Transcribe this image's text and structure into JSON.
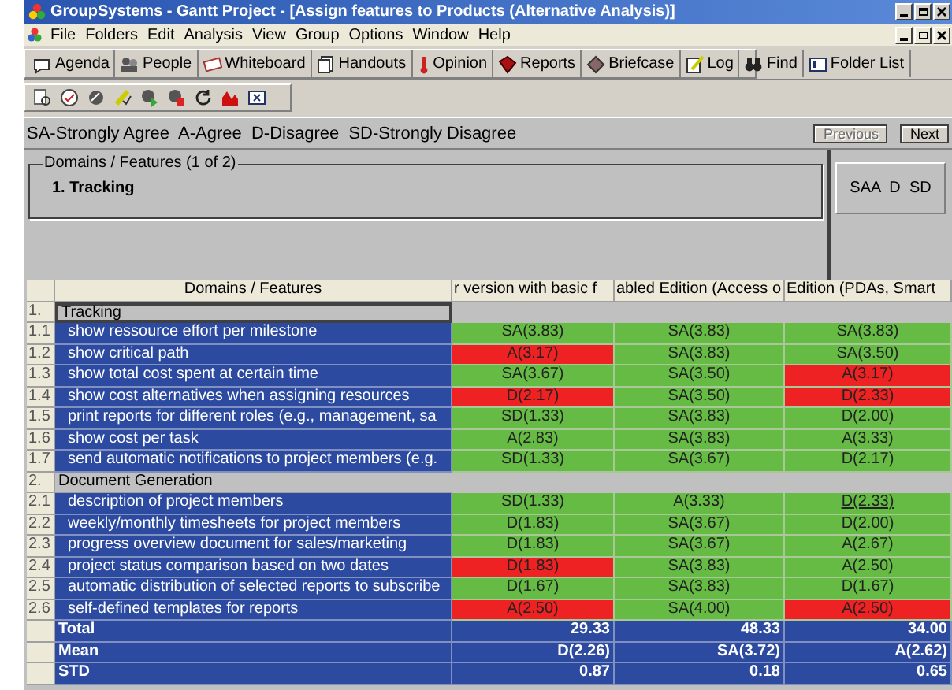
{
  "window": {
    "title": "GroupSystems - Gantt Project - [Assign features to Products (Alternative Analysis)]"
  },
  "menu": [
    "File",
    "Folders",
    "Edit",
    "Analysis",
    "View",
    "Group",
    "Options",
    "Window",
    "Help"
  ],
  "toolbar": [
    "Agenda",
    "People",
    "Whiteboard",
    "Handouts",
    "Opinion",
    "Reports",
    "Briefcase",
    "Log",
    "Find",
    "Folder List"
  ],
  "legend": "SA-Strongly Agree  A-Agree  D-Disagree  SD-Strongly Disagree",
  "nav_buttons": [
    {
      "label": "Previous",
      "disabled": true
    },
    {
      "label": "Next",
      "disabled": false
    }
  ],
  "panel": {
    "group_label": "Domains / Features (1 of 2)",
    "current": "1. Tracking",
    "scale": "SAA  D  SD"
  },
  "table": {
    "columns": [
      "Domains / Features",
      "r version with basic f",
      "abled Edition (Access o",
      "Edition (PDAs, Smart"
    ],
    "groups": [
      {
        "number": "1.",
        "name": "Tracking",
        "selected": true,
        "items": [
          {
            "number": "1.1",
            "text": "show ressource effort per milestone",
            "cells": [
              {
                "value": "SA(3.83)",
                "color": "#66bb44",
                "focused": false
              },
              {
                "value": "SA(3.83)",
                "color": "#66bb44",
                "focused": false
              },
              {
                "value": "SA(3.83)",
                "color": "#66bb44",
                "focused": false
              }
            ]
          },
          {
            "number": "1.2",
            "text": "show critical path",
            "cells": [
              {
                "value": "A(3.17)",
                "color": "#ee2222",
                "focused": false
              },
              {
                "value": "SA(3.83)",
                "color": "#66bb44",
                "focused": false
              },
              {
                "value": "SA(3.50)",
                "color": "#66bb44",
                "focused": false
              }
            ]
          },
          {
            "number": "1.3",
            "text": "show total cost spent at certain time",
            "cells": [
              {
                "value": "SA(3.67)",
                "color": "#66bb44",
                "focused": false
              },
              {
                "value": "SA(3.50)",
                "color": "#66bb44",
                "focused": false
              },
              {
                "value": "A(3.17)",
                "color": "#ee2222",
                "focused": false
              }
            ]
          },
          {
            "number": "1.4",
            "text": "show cost alternatives when assigning resources",
            "cells": [
              {
                "value": "D(2.17)",
                "color": "#ee2222",
                "focused": false
              },
              {
                "value": "SA(3.50)",
                "color": "#66bb44",
                "focused": false
              },
              {
                "value": "D(2.33)",
                "color": "#ee2222",
                "focused": false
              }
            ]
          },
          {
            "number": "1.5",
            "text": "print reports for different roles (e.g., management, sa",
            "cells": [
              {
                "value": "SD(1.33)",
                "color": "#66bb44",
                "focused": false
              },
              {
                "value": "SA(3.83)",
                "color": "#66bb44",
                "focused": false
              },
              {
                "value": "D(2.00)",
                "color": "#66bb44",
                "focused": false
              }
            ]
          },
          {
            "number": "1.6",
            "text": "show cost per task",
            "cells": [
              {
                "value": "A(2.83)",
                "color": "#66bb44",
                "focused": false
              },
              {
                "value": "SA(3.83)",
                "color": "#66bb44",
                "focused": false
              },
              {
                "value": "A(3.33)",
                "color": "#66bb44",
                "focused": false
              }
            ]
          },
          {
            "number": "1.7",
            "text": "send automatic notifications to project members (e.g.",
            "cells": [
              {
                "value": "SD(1.33)",
                "color": "#66bb44",
                "focused": false
              },
              {
                "value": "SA(3.67)",
                "color": "#66bb44",
                "focused": false
              },
              {
                "value": "D(2.17)",
                "color": "#66bb44",
                "focused": false
              }
            ]
          }
        ]
      },
      {
        "number": "2.",
        "name": "Document Generation",
        "selected": false,
        "items": [
          {
            "number": "2.1",
            "text": "description of project members",
            "cells": [
              {
                "value": "SD(1.33)",
                "color": "#66bb44",
                "focused": false
              },
              {
                "value": "A(3.33)",
                "color": "#66bb44",
                "focused": false
              },
              {
                "value": "D(2.33)",
                "color": "#66bb44",
                "focused": true
              }
            ]
          },
          {
            "number": "2.2",
            "text": "weekly/monthly timesheets for project members",
            "cells": [
              {
                "value": "D(1.83)",
                "color": "#66bb44",
                "focused": false
              },
              {
                "value": "SA(3.67)",
                "color": "#66bb44",
                "focused": false
              },
              {
                "value": "D(2.00)",
                "color": "#66bb44",
                "focused": false
              }
            ]
          },
          {
            "number": "2.3",
            "text": "progress overview document for sales/marketing",
            "cells": [
              {
                "value": "D(1.83)",
                "color": "#66bb44",
                "focused": false
              },
              {
                "value": "SA(3.67)",
                "color": "#66bb44",
                "focused": false
              },
              {
                "value": "A(2.67)",
                "color": "#66bb44",
                "focused": false
              }
            ]
          },
          {
            "number": "2.4",
            "text": "project status comparison based on two dates",
            "cells": [
              {
                "value": "D(1.83)",
                "color": "#ee2222",
                "focused": false
              },
              {
                "value": "SA(3.83)",
                "color": "#66bb44",
                "focused": false
              },
              {
                "value": "A(2.50)",
                "color": "#66bb44",
                "focused": false
              }
            ]
          },
          {
            "number": "2.5",
            "text": "automatic distribution of selected reports to subscribe",
            "cells": [
              {
                "value": "D(1.67)",
                "color": "#66bb44",
                "focused": false
              },
              {
                "value": "SA(3.83)",
                "color": "#66bb44",
                "focused": false
              },
              {
                "value": "D(1.67)",
                "color": "#66bb44",
                "focused": false
              }
            ]
          },
          {
            "number": "2.6",
            "text": "self-defined templates for reports",
            "cells": [
              {
                "value": "A(2.50)",
                "color": "#ee2222",
                "focused": false
              },
              {
                "value": "SA(4.00)",
                "color": "#66bb44",
                "focused": false
              },
              {
                "value": "A(2.50)",
                "color": "#ee2222",
                "focused": false
              }
            ]
          }
        ]
      }
    ],
    "summary": [
      {
        "label": "Total",
        "values": [
          "29.33",
          "48.33",
          "34.00"
        ]
      },
      {
        "label": "Mean",
        "values": [
          "D(2.26)",
          "SA(3.72)",
          "A(2.62)"
        ]
      },
      {
        "label": "STD",
        "values": [
          "0.87",
          "0.18",
          "0.65"
        ]
      }
    ]
  }
}
